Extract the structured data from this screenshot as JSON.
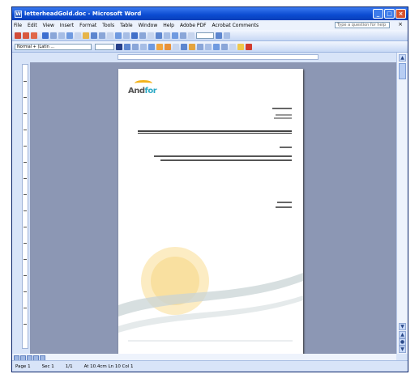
{
  "window": {
    "title": "letterheadGold.doc - Microsoft Word"
  },
  "menu": {
    "items": [
      "File",
      "Edit",
      "View",
      "Insert",
      "Format",
      "Tools",
      "Table",
      "Window",
      "Help",
      "Adobe PDF",
      "Acrobat Comments"
    ],
    "help_placeholder": "Type a question for help"
  },
  "format_toolbar": {
    "style": "Normal + (Latin ..."
  },
  "document": {
    "logo": {
      "brand_main": "And",
      "brand_accent": "for"
    }
  },
  "status": {
    "page": "Page 1",
    "section": "Sec 1",
    "page_of": "1/1",
    "position": "At 10.4cm  Ln 10  Col 1"
  },
  "colors": {
    "title_bar": "#0b4bd1",
    "doc_background": "#8c97b4",
    "logo_gold": "#f2b31c",
    "logo_teal": "#2aa8c4"
  }
}
